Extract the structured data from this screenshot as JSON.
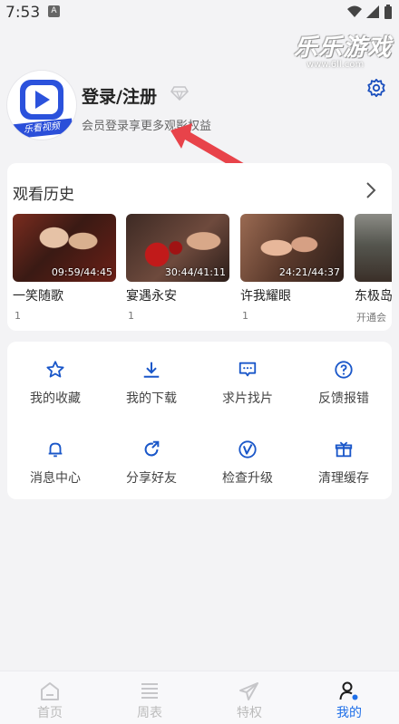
{
  "status_bar": {
    "time": "7:53",
    "notification_badge": "A"
  },
  "watermark": {
    "title": "乐乐游戏",
    "url": "www.6ll.com"
  },
  "profile": {
    "avatar_brand": "乐看视频",
    "login_label": "登录/注册",
    "subtitle": "会员登录享更多观影权益"
  },
  "history": {
    "title": "观看历史",
    "items": [
      {
        "title": "一笑随歌",
        "episode": "1",
        "time": "09:59/44:45"
      },
      {
        "title": "宴遇永安",
        "episode": "1",
        "time": "30:44/41:11"
      },
      {
        "title": "许我耀眼",
        "episode": "1",
        "time": "24:21/44:37"
      },
      {
        "title": "东极岛",
        "episode": "开通会",
        "time": ""
      }
    ]
  },
  "menu": {
    "items": [
      {
        "label": "我的收藏",
        "icon": "star-icon"
      },
      {
        "label": "我的下载",
        "icon": "download-icon"
      },
      {
        "label": "求片找片",
        "icon": "message-icon"
      },
      {
        "label": "反馈报错",
        "icon": "question-icon"
      },
      {
        "label": "消息中心",
        "icon": "bell-icon"
      },
      {
        "label": "分享好友",
        "icon": "share-icon"
      },
      {
        "label": "检查升级",
        "icon": "upgrade-icon"
      },
      {
        "label": "清理缓存",
        "icon": "gift-box-icon"
      }
    ]
  },
  "tabbar": {
    "items": [
      {
        "label": "首页",
        "icon": "home-icon"
      },
      {
        "label": "周表",
        "icon": "list-icon"
      },
      {
        "label": "特权",
        "icon": "paper-plane-icon"
      },
      {
        "label": "我的",
        "icon": "profile-icon"
      }
    ],
    "active_index": 3
  },
  "colors": {
    "accent": "#1e6fe8",
    "icon_blue": "#1a57c9",
    "background": "#f3f3f5",
    "annotation_arrow": "#e8434a"
  }
}
